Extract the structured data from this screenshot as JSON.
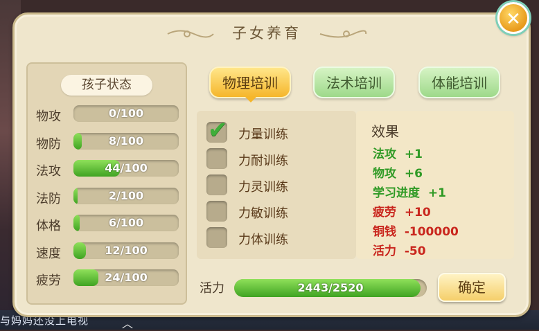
{
  "dialog": {
    "title": "子女养育",
    "close_label": "✕"
  },
  "background": {
    "bottom_text": "与妈妈还没上电视"
  },
  "status": {
    "heading": "孩子状态",
    "stats": [
      {
        "name": "物攻",
        "value": "0/100",
        "fill": 0.0
      },
      {
        "name": "物防",
        "value": "8/100",
        "fill": 0.08
      },
      {
        "name": "法攻",
        "value": "44/100",
        "fill": 0.44
      },
      {
        "name": "法防",
        "value": "2/100",
        "fill": 0.02
      },
      {
        "name": "体格",
        "value": "6/100",
        "fill": 0.06
      },
      {
        "name": "速度",
        "value": "12/100",
        "fill": 0.12
      },
      {
        "name": "疲劳",
        "value": "24/100",
        "fill": 0.24
      }
    ]
  },
  "tabs": [
    {
      "label": "物理培训",
      "active": true
    },
    {
      "label": "法术培训",
      "active": false
    },
    {
      "label": "体能培训",
      "active": false
    }
  ],
  "trainings": [
    {
      "label": "力量训练",
      "checked": true
    },
    {
      "label": "力耐训练",
      "checked": false
    },
    {
      "label": "力灵训练",
      "checked": false
    },
    {
      "label": "力敏训练",
      "checked": false
    },
    {
      "label": "力体训练",
      "checked": false
    }
  ],
  "effects": {
    "title": "效果",
    "lines": [
      {
        "text": "法攻  +1",
        "color": "green"
      },
      {
        "text": "物攻  +6",
        "color": "green"
      },
      {
        "text": "学习进度  +1",
        "color": "green"
      },
      {
        "text": "疲劳  +10",
        "color": "red"
      },
      {
        "text": "铜钱  -100000",
        "color": "red"
      },
      {
        "text": "活力  -50",
        "color": "red"
      }
    ]
  },
  "vitality": {
    "label": "活力",
    "value": "2443/2520",
    "fill": 0.9694
  },
  "confirm_label": "确定",
  "colors": {
    "accent_gold": "#f5b62b",
    "bar_green": "#3fa322",
    "effect_positive": "#2f9a25",
    "effect_negative": "#c9261d"
  }
}
